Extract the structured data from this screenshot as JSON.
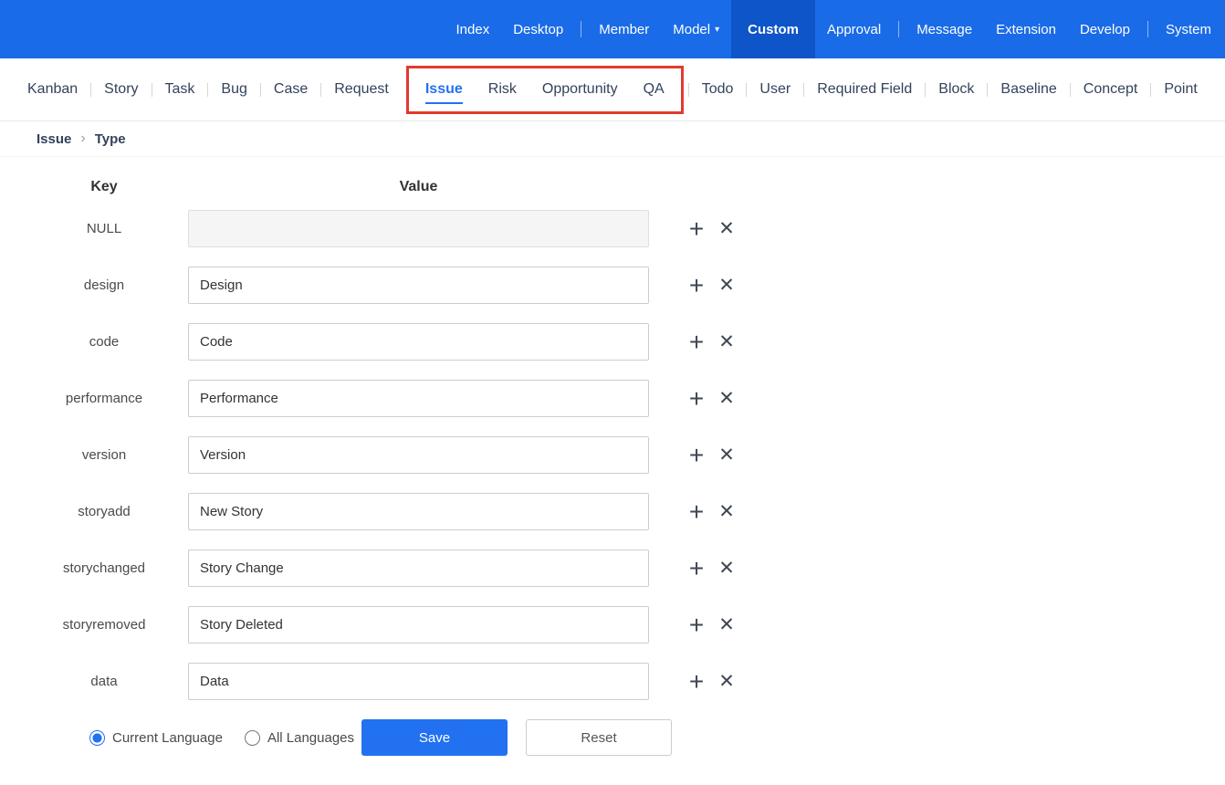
{
  "topbar": {
    "items": [
      "Index",
      "Desktop",
      "Member",
      "Model",
      "Custom",
      "Approval",
      "Message",
      "Extension",
      "Develop",
      "System"
    ]
  },
  "nav": {
    "items": [
      "Kanban",
      "Story",
      "Task",
      "Bug",
      "Case",
      "Request",
      "Issue",
      "Risk",
      "Opportunity",
      "QA",
      "Todo",
      "User",
      "Required Field",
      "Block",
      "Baseline",
      "Concept",
      "Point"
    ],
    "active": "Issue"
  },
  "breadcrumb": {
    "items": [
      "Issue",
      "Type"
    ]
  },
  "form": {
    "key_header": "Key",
    "value_header": "Value",
    "rows": [
      {
        "key": "NULL",
        "value": ""
      },
      {
        "key": "design",
        "value": "Design"
      },
      {
        "key": "code",
        "value": "Code"
      },
      {
        "key": "performance",
        "value": "Performance"
      },
      {
        "key": "version",
        "value": "Version"
      },
      {
        "key": "storyadd",
        "value": "New Story"
      },
      {
        "key": "storychanged",
        "value": "Story Change"
      },
      {
        "key": "storyremoved",
        "value": "Story Deleted"
      },
      {
        "key": "data",
        "value": "Data"
      }
    ]
  },
  "footer": {
    "current_language_label": "Current Language",
    "all_languages_label": "All Languages",
    "save_label": "Save",
    "reset_label": "Reset"
  },
  "icons": {
    "add": "+",
    "remove": "✕",
    "caret": "▾",
    "chevron": "›"
  },
  "colors": {
    "topbar_blue": "#1a6be8",
    "topbar_active_blue": "#0d55c8",
    "accent_blue": "#2271f1",
    "annotation_red": "#e23a2e"
  }
}
